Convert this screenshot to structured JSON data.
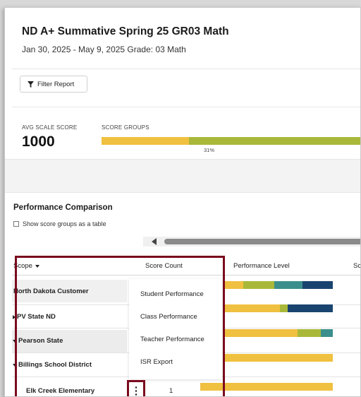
{
  "report": {
    "title": "ND A+ Summative Spring 25 GR03 Math",
    "subtitle": "Jan 30, 2025 - May 9, 2025   Grade: 03   Math"
  },
  "filter_button": {
    "label": "Filter Report",
    "icon": "funnel-icon"
  },
  "summary": {
    "avg_label": "AVG SCALE SCORE",
    "avg_value": "1000",
    "score_groups_label": "SCORE GROUPS",
    "score_groups_pct_label": "31%",
    "score_groups_segments": [
      {
        "color": "#f0c040",
        "fraction": 0.31
      },
      {
        "color": "#aab83a",
        "fraction": 0.69
      }
    ]
  },
  "performance_comparison": {
    "title": "Performance Comparison",
    "show_table_label": "Show score groups as a table",
    "show_table_checked": false,
    "columns": {
      "scope": "Scope",
      "score_count": "Score Count",
      "performance_level": "Performance Level",
      "truncated": "Sc"
    },
    "rows": [
      {
        "label": "North Dakota Customer",
        "expander": "none",
        "segments": [
          {
            "color": "#f0c040",
            "fraction": 0.17
          },
          {
            "color": "#aab83a",
            "fraction": 0.29
          },
          {
            "color": "#3a8f8c",
            "fraction": 0.26
          },
          {
            "color": "#1a4470",
            "fraction": 0.28
          }
        ]
      },
      {
        "label": "PV State ND",
        "expander": "right",
        "segments": [
          {
            "color": "#f0c040",
            "fraction": 0.51
          },
          {
            "color": "#aab83a",
            "fraction": 0.07
          },
          {
            "color": "#1a4470",
            "fraction": 0.42
          }
        ]
      },
      {
        "label": "Pearson State",
        "expander": "down",
        "segments": [
          {
            "color": "#f0c040",
            "fraction": 0.67
          },
          {
            "color": "#aab83a",
            "fraction": 0.22
          },
          {
            "color": "#3a8f8c",
            "fraction": 0.11
          }
        ]
      },
      {
        "label": "Billings School District",
        "expander": "down",
        "segments": [
          {
            "color": "#f0c040",
            "fraction": 1.0
          }
        ]
      },
      {
        "label": "Elk Creek Elementary",
        "expander": "indent",
        "score_count": "1",
        "segments": [
          {
            "color": "#f0c040",
            "fraction": 1.0
          }
        ]
      }
    ]
  },
  "context_menu": {
    "items": [
      "Student Performance",
      "Class Performance",
      "Teacher Performance",
      "ISR Export"
    ]
  },
  "kebab_button": {
    "glyph": "⋮",
    "icon": "kebab-menu-icon"
  }
}
